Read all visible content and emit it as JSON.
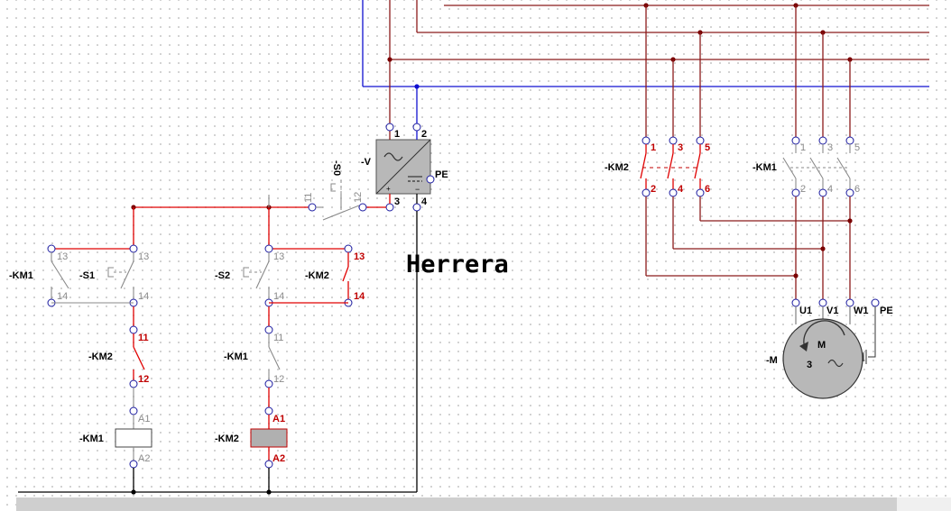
{
  "watermark": "Herrera",
  "control": {
    "s0": "-S0",
    "v": "-V",
    "km1_left": "-KM1",
    "s1": "-S1",
    "s2": "-S2",
    "km2_hold": "-KM2",
    "km2_interlock": "-KM2",
    "km1_interlock": "-KM1",
    "coil_km1": "-KM1",
    "coil_km2": "-KM2",
    "v_terminals": [
      "1",
      "2",
      "3",
      "4",
      "PE"
    ],
    "s0_terminals": [
      "11",
      "12"
    ],
    "t13": "13",
    "t14": "14",
    "t11": "11",
    "t12": "12",
    "a1": "A1",
    "a2": "A2"
  },
  "power": {
    "km2": "-KM2",
    "km1": "-KM1",
    "motor": "-M",
    "motor_symbol": "M",
    "motor_phases": "3",
    "motor_terminals": [
      "U1",
      "V1",
      "W1",
      "PE"
    ],
    "top_terminals": [
      "1",
      "3",
      "5"
    ],
    "bottom_terminals": [
      "2",
      "4",
      "6"
    ]
  },
  "colors": {
    "wire_main": "#8b1a1a",
    "wire_live": "#e00000",
    "wire_neutral": "#1010d0",
    "wire_ground": "#000000",
    "active_label": "#c00000",
    "inactive_label": "#8a8a8a",
    "active_coil": "#b0b0b0"
  }
}
